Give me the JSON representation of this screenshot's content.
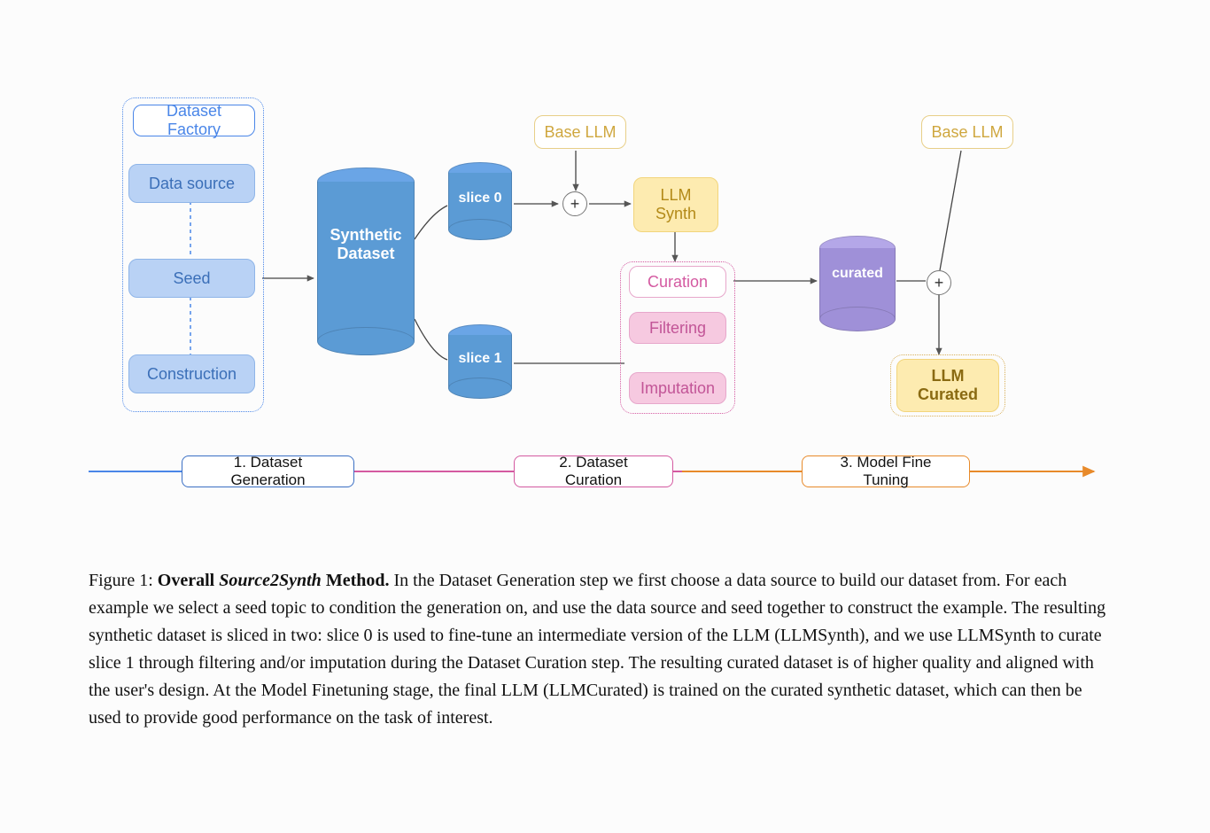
{
  "factory": {
    "title": "Dataset Factory",
    "data_source": "Data source",
    "seed": "Seed",
    "construction": "Construction"
  },
  "cylinders": {
    "synthetic": "Synthetic\nDataset",
    "slice0": "slice 0",
    "slice1": "slice 1",
    "curated": "curated"
  },
  "yellow": {
    "base_llm_1": "Base LLM",
    "base_llm_2": "Base LLM",
    "llm_synth": "LLM\nSynth",
    "llm_curated": "LLM\nCurated"
  },
  "pink": {
    "curation": "Curation",
    "filtering": "Filtering",
    "imputation": "Imputation"
  },
  "timeline": {
    "step1": "1. Dataset Generation",
    "step2": "2. Dataset Curation",
    "step3": "3. Model Fine Tuning"
  },
  "caption": {
    "fig_label": "Figure 1: ",
    "title_bold": "Overall ",
    "title_italic": "Source2Synth",
    "title_bold2": " Method.",
    "body": " In the Dataset Generation step we first choose a data source to build our dataset from. For each example we select a seed topic to condition the generation on, and use the data source and seed together to construct the example. The resulting synthetic dataset is sliced in two: slice 0 is used to fine-tune an intermediate version of the LLM (LLMSynth), and we use LLMSynth to curate slice 1 through filtering and/or imputation during the Dataset Curation step. The resulting curated dataset is of higher quality and aligned with the user's design. At the Model Finetuning stage, the final LLM (LLMCurated) is trained on the curated synthetic dataset, which can then be used to provide good performance on the task of interest."
  },
  "colors": {
    "blue": "#5b9bd5",
    "blue_dark": "#3b6fb8",
    "purple": "#9f90d8",
    "yellow": "#fdebb0",
    "pink": "#d45aa1",
    "orange": "#e88a2a"
  }
}
